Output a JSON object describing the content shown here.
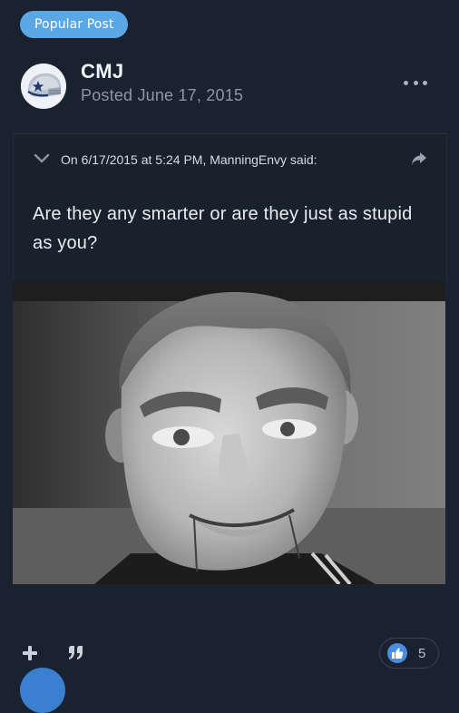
{
  "badge": {
    "label": "Popular Post",
    "color": "#5aa7e6"
  },
  "post": {
    "author": "CMJ",
    "posted": "Posted June 17, 2015",
    "avatar_icon": "helmet-avatar-icon",
    "more_icon": "ellipsis-icon"
  },
  "quote": {
    "citation": "On 6/17/2015 at 5:24 PM, ManningEnvy said:",
    "text": "Are they any smarter or are they just as stupid as you?",
    "collapse_icon": "chevron-down-icon",
    "share_icon": "share-arrow-icon"
  },
  "image": {
    "icon": "ventriloquist-dummy-photo"
  },
  "footer": {
    "add_icon": "plus-icon",
    "quote_icon": "quote-icon",
    "reaction_icon": "thumbs-up-icon",
    "reaction_count": "5",
    "accent": "#4a8ee4"
  }
}
